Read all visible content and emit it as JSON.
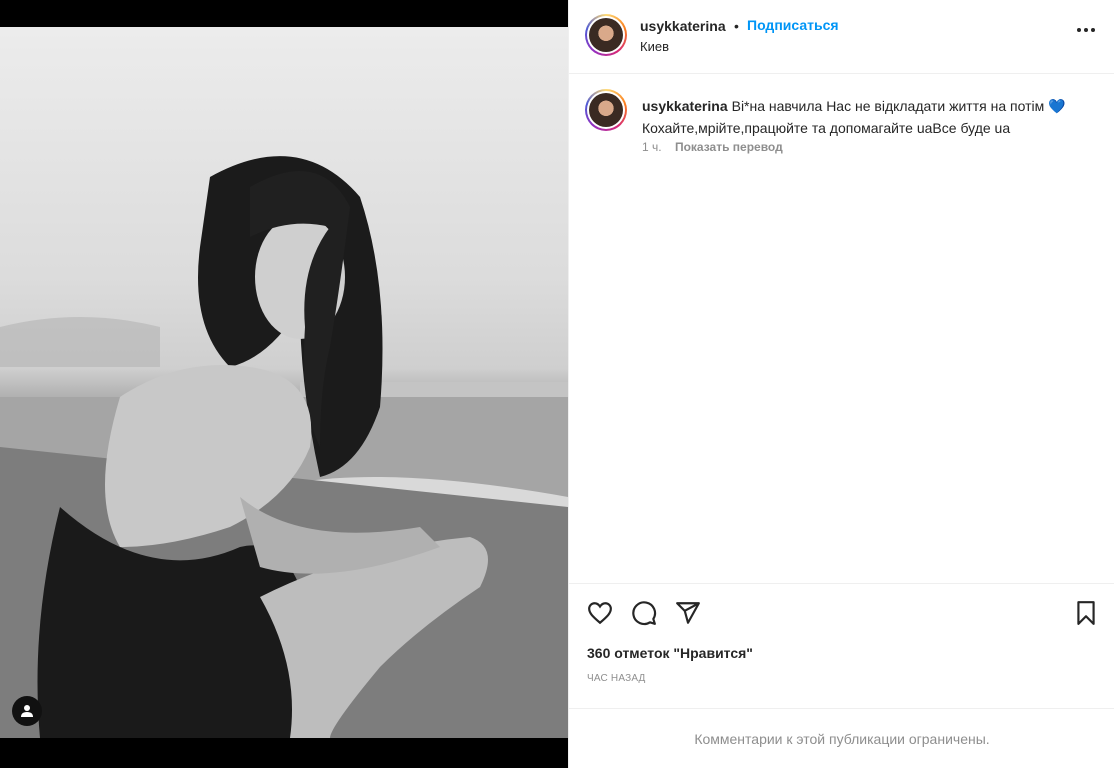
{
  "post": {
    "username": "usykkaterina",
    "dot": "•",
    "follow_label": "Подписаться",
    "location": "Киев",
    "caption_user": "usykkaterina",
    "caption_text": "Ві*на навчила Нас не відкладати життя на потім 💙Кохайте,мрійте,працюйте та допомагайте uaВсе буде ua",
    "caption_time": "1 ч.",
    "translate_label": "Показать перевод",
    "likes": "360 отметок \"Нравится\"",
    "time_ago": "ЧАС НАЗАД",
    "comments_restricted": "Комментарии к этой публикации ограничены."
  },
  "icons": {
    "like": "heart-icon",
    "comment": "comment-icon",
    "share": "share-icon",
    "save": "bookmark-icon",
    "more": "more-options-icon",
    "tag": "user-tag-icon"
  },
  "colors": {
    "link": "#0095f6",
    "text": "#262626",
    "muted": "#8e8e8e",
    "heart_emoji": "#1f6fd1"
  }
}
